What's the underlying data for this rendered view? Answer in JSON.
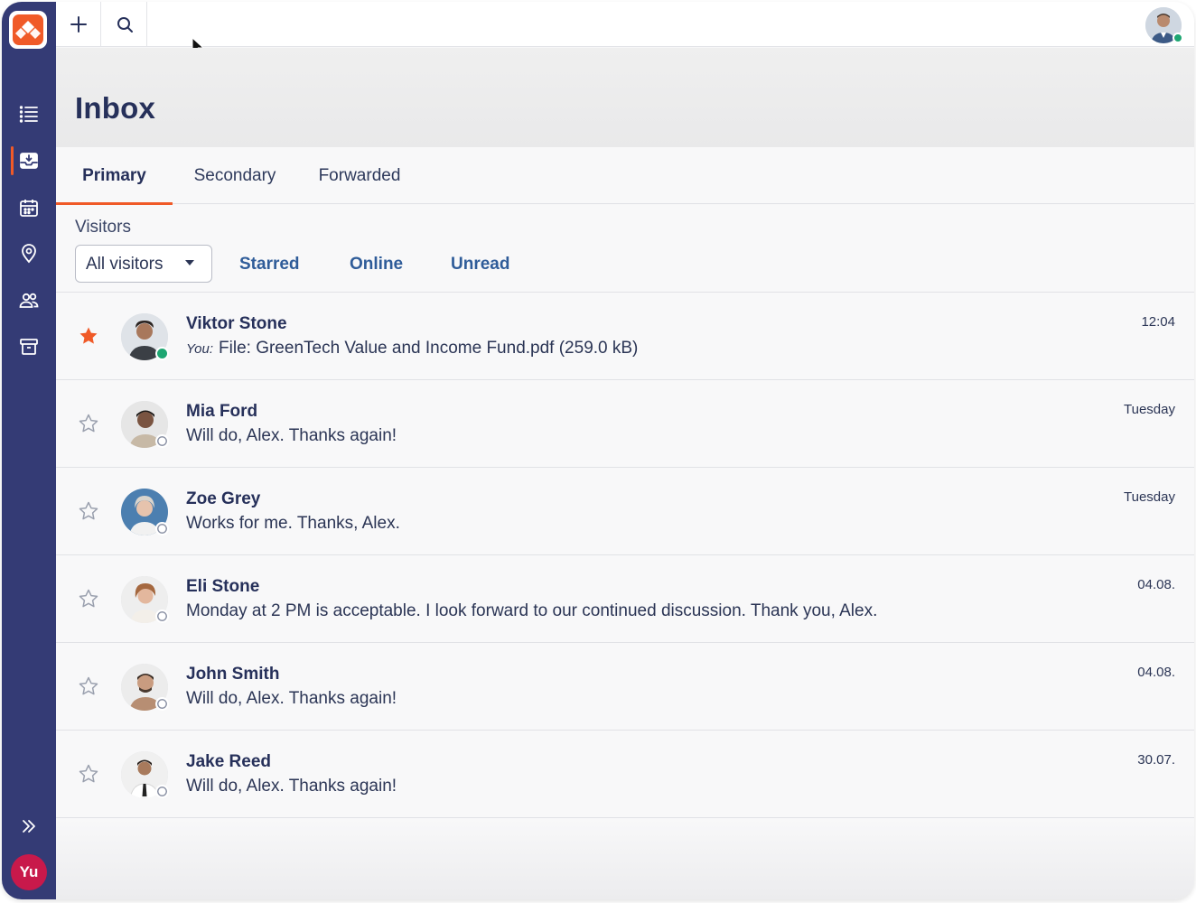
{
  "topbar": {
    "add_icon": "plus-icon",
    "search_icon": "search-icon"
  },
  "sidebar": {
    "items": [
      {
        "name": "list-icon",
        "active": false
      },
      {
        "name": "inbox-icon",
        "active": true
      },
      {
        "name": "calendar-icon",
        "active": false
      },
      {
        "name": "location-pin-icon",
        "active": false
      },
      {
        "name": "contacts-icon",
        "active": false
      },
      {
        "name": "archive-icon",
        "active": false
      }
    ],
    "user_initials": "Yu"
  },
  "header": {
    "title": "Inbox"
  },
  "tabs": [
    {
      "label": "Primary",
      "active": true
    },
    {
      "label": "Secondary",
      "active": false
    },
    {
      "label": "Forwarded",
      "active": false
    }
  ],
  "filters": {
    "label": "Visitors",
    "select_value": "All visitors",
    "links": [
      "Starred",
      "Online",
      "Unread"
    ]
  },
  "conversations": [
    {
      "name": "Viktor Stone",
      "you_prefix": "You:",
      "preview": "File: GreenTech Value and Income Fund.pdf (259.0 kB)",
      "time": "12:04",
      "starred": true,
      "status": "online"
    },
    {
      "name": "Mia Ford",
      "you_prefix": "",
      "preview": "Will do, Alex. Thanks again!",
      "time": "Tuesday",
      "starred": false,
      "status": "offline"
    },
    {
      "name": "Zoe Grey",
      "you_prefix": "",
      "preview": "Works for me. Thanks, Alex.",
      "time": "Tuesday",
      "starred": false,
      "status": "offline"
    },
    {
      "name": "Eli Stone",
      "you_prefix": "",
      "preview": "Monday at 2 PM is acceptable. I look forward to our continued discussion. Thank you, Alex.",
      "time": "04.08.",
      "starred": false,
      "status": "offline"
    },
    {
      "name": "John Smith",
      "you_prefix": "",
      "preview": "Will do, Alex. Thanks again!",
      "time": "04.08.",
      "starred": false,
      "status": "offline"
    },
    {
      "name": "Jake Reed",
      "you_prefix": "",
      "preview": "Will do, Alex. Thanks again!",
      "time": "30.07.",
      "starred": false,
      "status": "offline"
    }
  ],
  "colors": {
    "sidebar": "#343b75",
    "accent": "#f05a28",
    "link": "#2f5c99",
    "online": "#1ea672",
    "user_avatar": "#c8194b"
  }
}
